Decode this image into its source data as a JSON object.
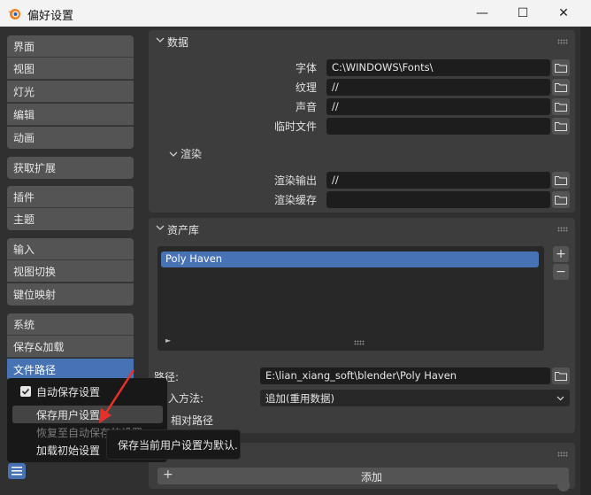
{
  "window": {
    "title": "偏好设置",
    "minimize_glyph": "—",
    "maximize_glyph": "☐",
    "close_glyph": "✕"
  },
  "sidebar": {
    "items": [
      {
        "label": "界面"
      },
      {
        "label": "视图"
      },
      {
        "label": "灯光"
      },
      {
        "label": "编辑"
      },
      {
        "label": "动画"
      },
      {
        "label": "获取扩展"
      },
      {
        "label": "插件"
      },
      {
        "label": "主题"
      },
      {
        "label": "输入"
      },
      {
        "label": "视图切换"
      },
      {
        "label": "键位映射"
      },
      {
        "label": "系统"
      },
      {
        "label": "保存&加载"
      },
      {
        "label": "文件路径",
        "active": true
      }
    ]
  },
  "data_panel": {
    "title": "数据",
    "rows": [
      {
        "label": "字体",
        "value": "C:\\WINDOWS\\Fonts\\"
      },
      {
        "label": "纹理",
        "value": "//"
      },
      {
        "label": "声音",
        "value": "//"
      },
      {
        "label": "临时文件",
        "value": ""
      }
    ],
    "render_section": {
      "title": "渲染",
      "rows": [
        {
          "label": "渲染输出",
          "value": "//"
        },
        {
          "label": "渲染缓存",
          "value": ""
        }
      ]
    }
  },
  "asset_panel": {
    "title": "资产库",
    "libraries": [
      "Poly Haven"
    ],
    "add_glyph": "+",
    "remove_glyph": "−",
    "expand_glyph": "►",
    "path_label": "路径:",
    "path_value": "E:\\lian_xiang_soft\\blender\\Poly Haven",
    "import_label": "入方法:",
    "import_value": "追加(重用数据)",
    "relative_label": "相对路径"
  },
  "bottom_panel": {
    "add_label": "添加",
    "add_glyph": "+"
  },
  "popup_menu": {
    "items": [
      {
        "label": "自动保存设置",
        "checked": true
      },
      {
        "label": "保存用户设置",
        "hover": true
      },
      {
        "label": "恢复至自动保存的设置",
        "disabled": true
      },
      {
        "label": "加载初始设置"
      }
    ]
  },
  "tooltip": {
    "text": "保存当前用户设置为默认."
  },
  "colors": {
    "accent": "#4772b3",
    "arrow": "#e8302a",
    "panel": "#3d3d3d",
    "field": "#1d1d1d"
  }
}
